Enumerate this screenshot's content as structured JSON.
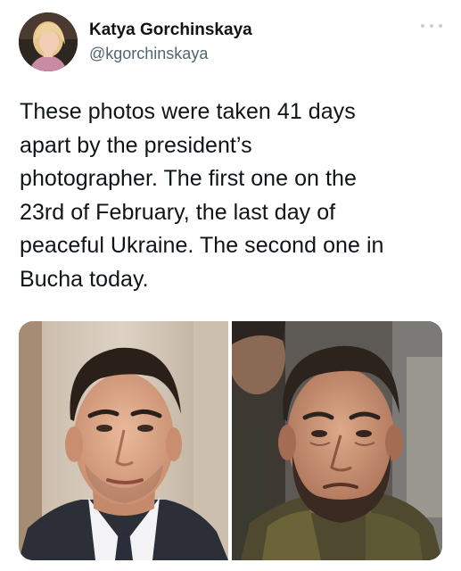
{
  "author": {
    "name": "Katya Gorchinskaya",
    "handle": "@kgorchinskaya"
  },
  "tweet": {
    "lines": [
      "These photos were taken 41 days",
      "apart by the president’s",
      "photographer. The first one on the",
      "23rd of February, the last day of",
      "peaceful Ukraine. The second one in",
      "Bucha today."
    ]
  },
  "icons": {
    "more": "more-horizontal-icon"
  }
}
